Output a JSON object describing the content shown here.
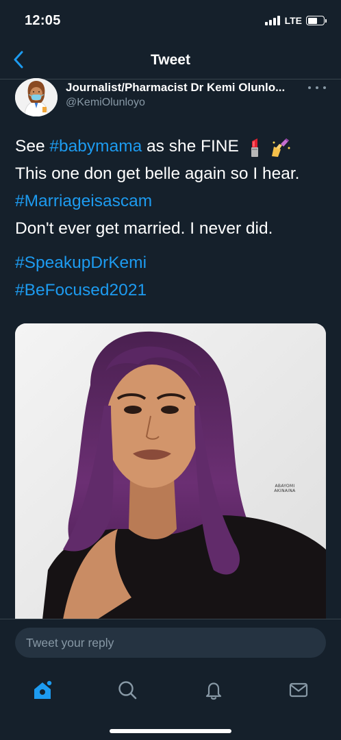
{
  "status_bar": {
    "time": "12:05",
    "network": "LTE"
  },
  "header": {
    "title": "Tweet",
    "back_icon": "chevron-left-icon"
  },
  "author": {
    "name": "Journalist/Pharmacist Dr Kemi Olunlo...",
    "handle": "@KemiOlunloyo",
    "more_icon": "more-horizontal-icon"
  },
  "tweet": {
    "line1_prefix": "See ",
    "line1_hashtag": "#babymama",
    "line1_suffix": " as she FINE",
    "line1_emojis": [
      "lipstick-emoji",
      "nail-polish-emoji"
    ],
    "line2": "This one don get belle again so I hear.",
    "line3_hashtag": "#Marriageisascam",
    "line4": "Don't ever get married. I never did.",
    "hashtags": [
      "#SpeakupDrKemi",
      "#BeFocused2021"
    ]
  },
  "media": {
    "watermark_line1": "ABAYOMI",
    "watermark_line2": "AKINAINA"
  },
  "reply": {
    "placeholder": "Tweet your reply"
  },
  "tabs": [
    {
      "icon": "home-icon",
      "active": true
    },
    {
      "icon": "search-icon",
      "active": false
    },
    {
      "icon": "notifications-bell-icon",
      "active": false
    },
    {
      "icon": "messages-mail-icon",
      "active": false
    }
  ],
  "colors": {
    "background": "#15202b",
    "accent": "#1d9bf0",
    "secondary_text": "#8899a6",
    "divider": "#38444d"
  }
}
